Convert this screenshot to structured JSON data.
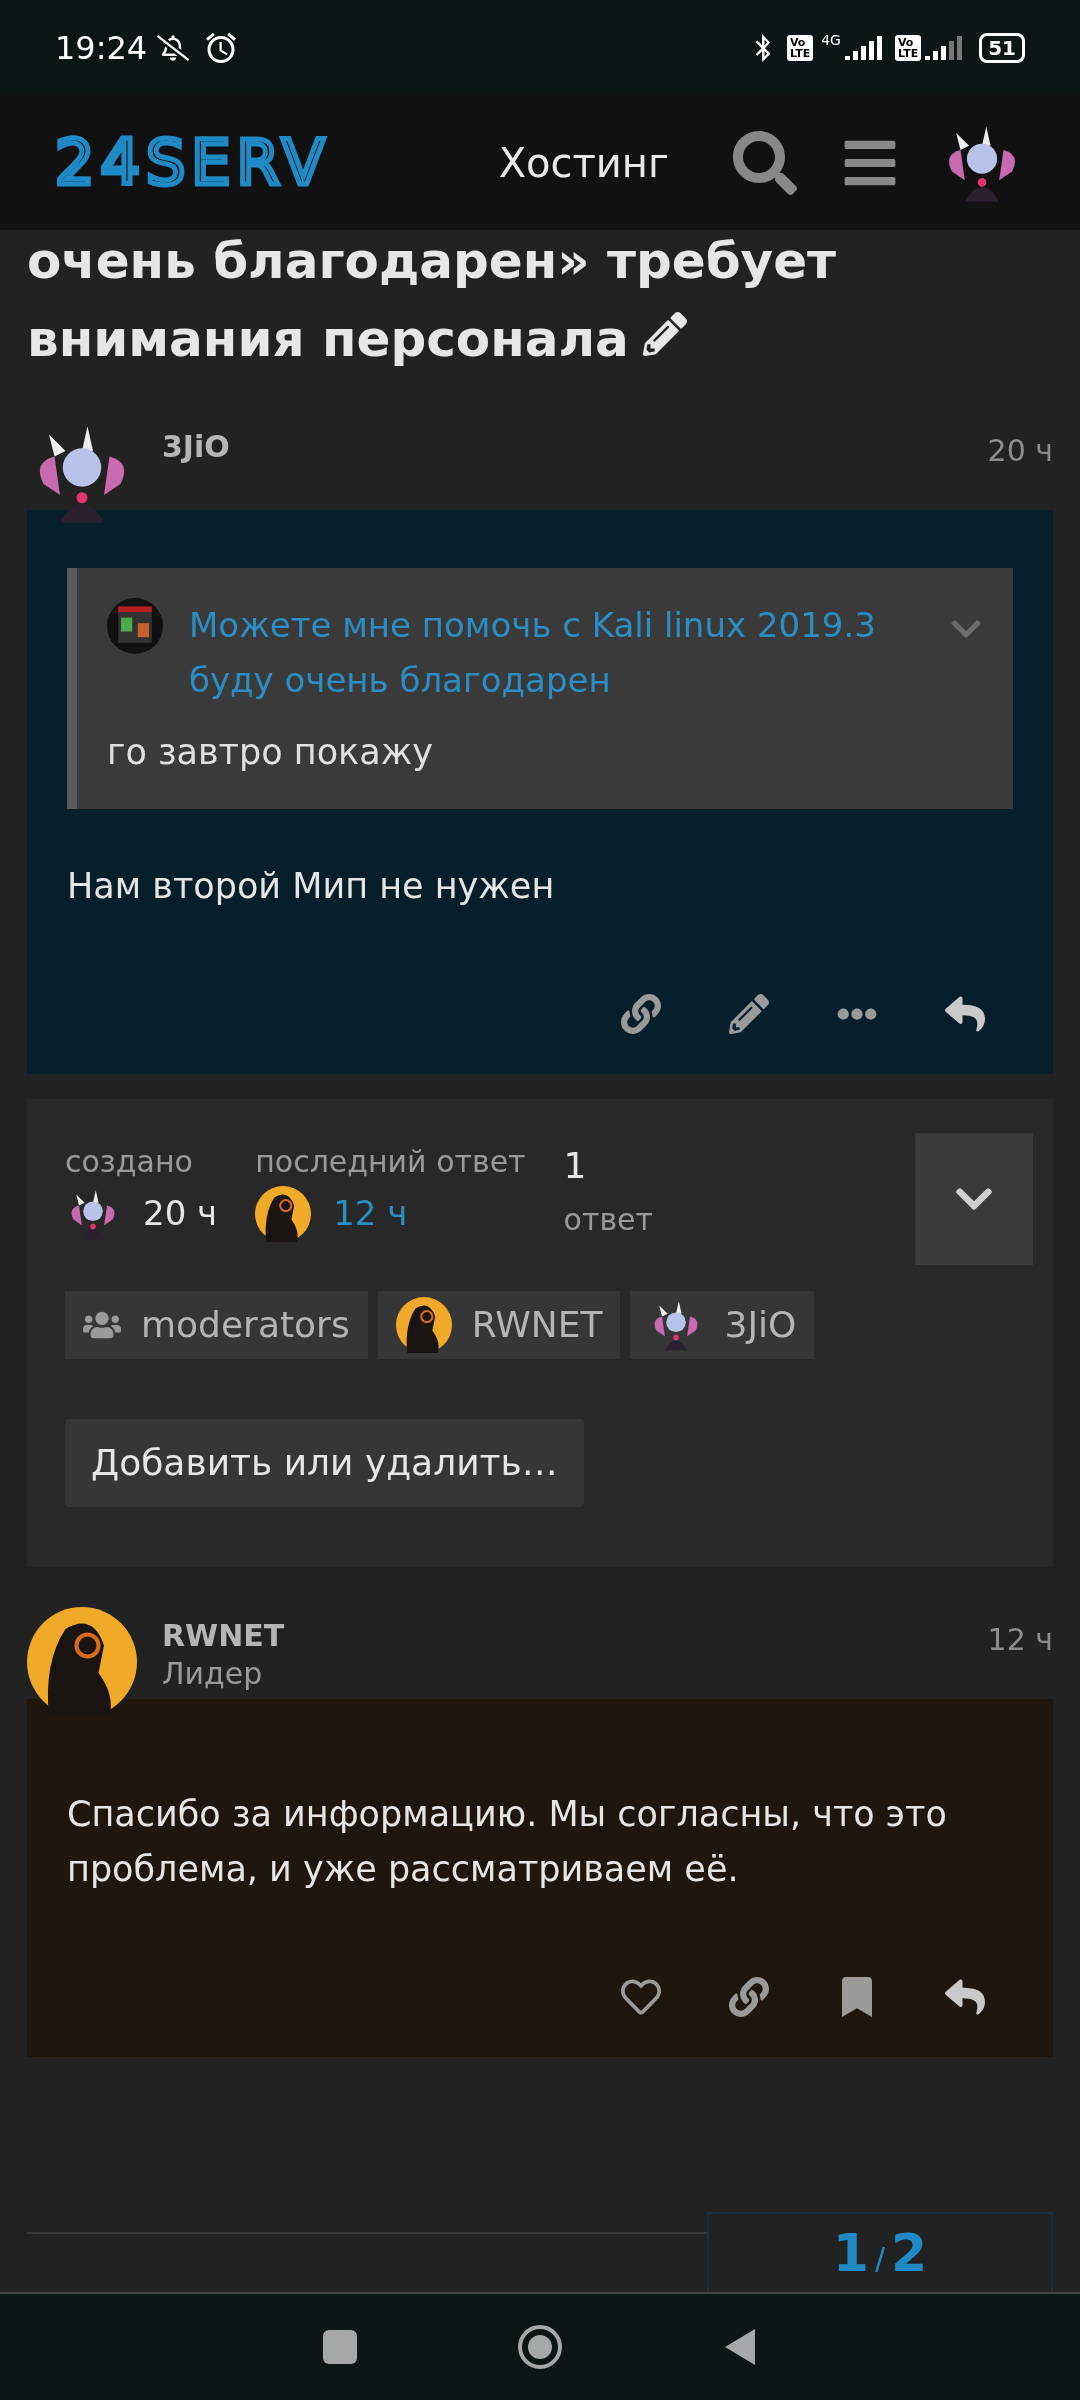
{
  "status_bar": {
    "time": "19:24",
    "volte_badges": [
      {
        "top": "Vo",
        "bottom": "LTE"
      },
      {
        "top": "Vo",
        "bottom": "LTE"
      }
    ],
    "network": "4G",
    "battery": "51"
  },
  "header": {
    "logo": "24SERV",
    "nav_link": "Хостинг",
    "user_avatar": {
      "kind": "anime"
    }
  },
  "topic_title": "очень благодарен» требует внимания персонала",
  "posts": [
    {
      "username": "3JiO",
      "time": "20 ч",
      "avatar": {
        "kind": "anime"
      },
      "color": "#061f2a",
      "quote": {
        "avatar": {
          "kind": "cube"
        },
        "title": "Можете мне помочь с Kali linux 2019.3 буду очень благодарен",
        "text": "го завтро покажу"
      },
      "body": "Нам второй Мип не нужен",
      "actions": [
        {
          "kind": "link"
        },
        {
          "kind": "edit"
        },
        {
          "kind": "more"
        },
        {
          "kind": "reply"
        }
      ]
    },
    {
      "username": "RWNET",
      "user_title": "Лидер",
      "time": "12 ч",
      "avatar": {
        "kind": "dark"
      },
      "color": "#1f170e",
      "body": "Спасибо за информацию. Мы согласны, что это проблема, и уже рассматриваем её.",
      "actions": [
        {
          "kind": "like"
        },
        {
          "kind": "link"
        },
        {
          "kind": "bookmark"
        },
        {
          "kind": "reply"
        }
      ]
    }
  ],
  "topic_map": {
    "created_label": "создано",
    "created_avatar": {
      "kind": "anime"
    },
    "created_time": "20 ч",
    "last_reply_label": "последний ответ",
    "last_reply_avatar": {
      "kind": "dark"
    },
    "last_reply_time": "12 ч",
    "replies_count": "1",
    "replies_label": "ответ",
    "participants": [
      {
        "kind": "group",
        "name": "moderators"
      },
      {
        "kind": "user",
        "avatar": {
          "kind": "dark"
        },
        "name": "RWNET"
      },
      {
        "kind": "user",
        "avatar": {
          "kind": "anime"
        },
        "name": "3JiO"
      }
    ],
    "add_button": "Добавить или удалить…"
  },
  "progress": {
    "current": "1",
    "separator": "/",
    "total": "2"
  }
}
